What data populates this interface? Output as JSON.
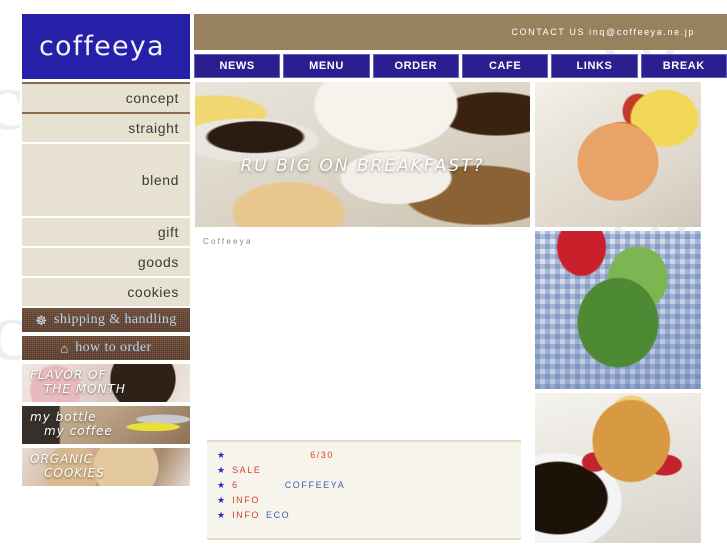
{
  "site": {
    "logo_text": "coffeeya",
    "logo_bg": "#2620a8",
    "accent_tan": "#97815f",
    "nav_bg": "#2a1f8e",
    "sidebar_bg": "#e7e1d2"
  },
  "header": {
    "contact_text": "CONTACT US inq@coffeeya.ne.jp"
  },
  "nav": {
    "items": [
      {
        "label": "NEWS"
      },
      {
        "label": "MENU"
      },
      {
        "label": "ORDER"
      },
      {
        "label": "CAFE"
      },
      {
        "label": "LINKS"
      },
      {
        "label": "BREAK"
      }
    ]
  },
  "sidebar": {
    "items": [
      {
        "label": "concept",
        "height": 28
      },
      {
        "label": "straight",
        "height": 28
      },
      {
        "label": "blend",
        "height": 72
      },
      {
        "label": "gift",
        "height": 28
      },
      {
        "label": "goods",
        "height": 28
      },
      {
        "label": "cookies",
        "height": 28
      }
    ],
    "buttons": [
      {
        "label": "shipping & handling",
        "icon": "bicycle-icon",
        "glyph": "☸"
      },
      {
        "label": "how to order",
        "icon": "shopping-bag-icon",
        "glyph": "⌂"
      }
    ],
    "banners": [
      {
        "line1": "FLAVOR OF",
        "line2": "THE MONTH",
        "name": "flavor-of-the-month"
      },
      {
        "line1": "my bottle",
        "line2": "my coffee",
        "name": "my-bottle-my-coffee"
      },
      {
        "line1": "ORGANIC",
        "line2": "COOKIES",
        "name": "organic-cookies"
      }
    ]
  },
  "hero": {
    "overlay_text": "RU BIG ON BREAKFAST?",
    "alt": "breakfast-table-photo"
  },
  "main": {
    "content_label": "Coffeeya"
  },
  "news": {
    "rows": [
      {
        "indent": 78,
        "red": "6/30",
        "blue": ""
      },
      {
        "indent": 0,
        "red": "SALE",
        "blue": ""
      },
      {
        "indent": 0,
        "red": "6",
        "blue": "COFFEEYA",
        "gap": 46
      },
      {
        "indent": 0,
        "red": "INFO",
        "blue": ""
      },
      {
        "indent": 0,
        "red": "INFO",
        "blue": "ECO",
        "gap": 6
      }
    ],
    "star_glyph": "★",
    "red": "#d2432e",
    "blue": "#3a5fb0"
  },
  "photos": {
    "right": [
      {
        "name": "hotdog-photo"
      },
      {
        "name": "salad-photo"
      },
      {
        "name": "pancakes-photo"
      }
    ]
  },
  "watermark": {
    "text": "coffeeya"
  }
}
